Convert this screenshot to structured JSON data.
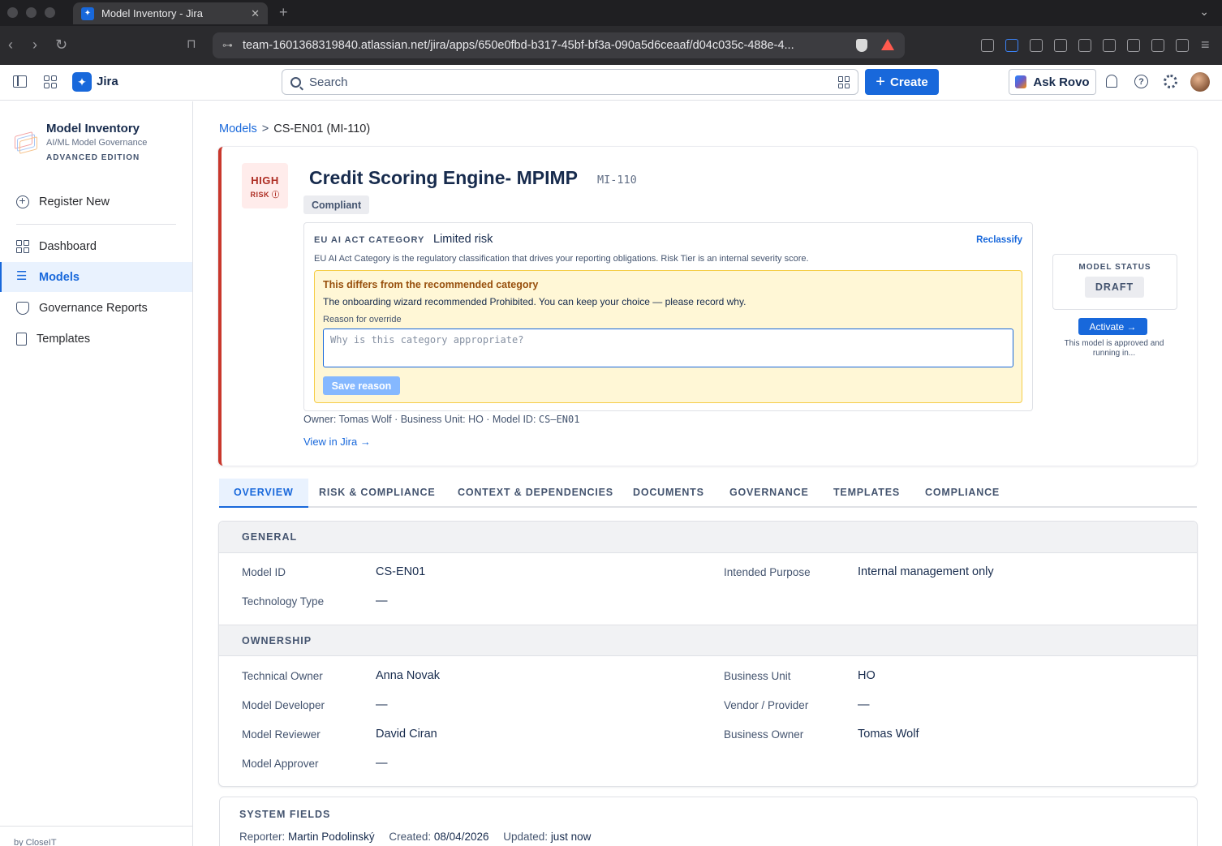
{
  "browser": {
    "tab_title": "Model Inventory - Jira",
    "url": "team-1601368319840.atlassian.net/jira/apps/650e0fbd-b317-45bf-bf3a-090a5d6ceaaf/d04c035c-488e-4..."
  },
  "topnav": {
    "product": "Jira",
    "search_placeholder": "Search",
    "create_label": "Create",
    "rovo_label": "Ask Rovo"
  },
  "sidebar": {
    "app_name": "Model Inventory",
    "app_subtitle": "AI/ML Model Governance",
    "edition": "ADVANCED EDITION",
    "register_label": "Register New",
    "items": [
      {
        "label": "Dashboard"
      },
      {
        "label": "Models"
      },
      {
        "label": "Governance Reports"
      },
      {
        "label": "Templates"
      }
    ],
    "footer": "by CloseIT"
  },
  "breadcrumb": {
    "parent": "Models",
    "separator": ">",
    "current": "CS-EN01 (MI-110)"
  },
  "model": {
    "risk_level": "HIGH",
    "risk_label": "RISK ⓘ",
    "title": "Credit Scoring Engine- MPIMP",
    "key": "MI-110",
    "compliance_badge": "Compliant",
    "eu_category_label": "EU AI ACT CATEGORY",
    "eu_category_value": "Limited risk",
    "reclassify_label": "Reclassify",
    "eu_description": "EU AI Act Category is the regulatory classification that drives your reporting obligations. Risk Tier is an internal severity score.",
    "warning_title": "This differs from the recommended category",
    "warning_body": "The onboarding wizard recommended Prohibited. You can keep your choice — please record why.",
    "reason_label": "Reason for override",
    "reason_placeholder": "Why is this category appropriate?",
    "save_reason_label": "Save reason",
    "owner_text": "Owner: Tomas Wolf · Business Unit: HO · Model ID: ",
    "owner_model_id": "CS–EN01",
    "view_in_jira": "View in Jira →",
    "status_label": "MODEL STATUS",
    "status_value": "DRAFT",
    "activate_label": "Activate →",
    "activate_note": "This model is approved and running in..."
  },
  "tabs": [
    {
      "label": "OVERVIEW"
    },
    {
      "label": "RISK & COMPLIANCE"
    },
    {
      "label": "CONTEXT & DEPENDENCIES"
    },
    {
      "label": "DOCUMENTS"
    },
    {
      "label": "GOVERNANCE"
    },
    {
      "label": "TEMPLATES"
    },
    {
      "label": "COMPLIANCE"
    }
  ],
  "general": {
    "heading": "GENERAL",
    "fields": [
      {
        "label": "Model ID",
        "value": "CS-EN01"
      },
      {
        "label": "Intended Purpose",
        "value": "Internal management only"
      },
      {
        "label": "Technology Type",
        "value": "—"
      }
    ]
  },
  "ownership": {
    "heading": "OWNERSHIP",
    "fields": [
      {
        "label": "Technical Owner",
        "value": "Anna Novak"
      },
      {
        "label": "Business Unit",
        "value": "HO"
      },
      {
        "label": "Model Developer",
        "value": "—"
      },
      {
        "label": "Vendor / Provider",
        "value": "—"
      },
      {
        "label": "Model Reviewer",
        "value": "David Ciran"
      },
      {
        "label": "Business Owner",
        "value": "Tomas Wolf"
      },
      {
        "label": "Model Approver",
        "value": "—"
      }
    ]
  },
  "system": {
    "heading": "SYSTEM FIELDS",
    "reporter_label": "Reporter:",
    "reporter": "Martin Podolinský",
    "created_label": "Created:",
    "created": "08/04/2026",
    "updated_label": "Updated:",
    "updated": "just now"
  },
  "colors": {
    "accent": "#1868db",
    "risk_high": "#c9372c",
    "warning_bg": "#fff7d6"
  }
}
